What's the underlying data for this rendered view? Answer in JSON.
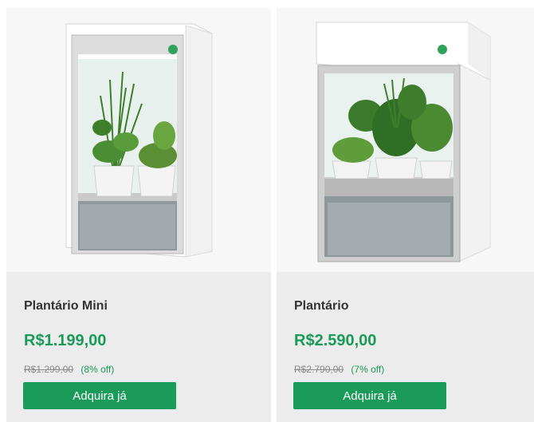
{
  "colors": {
    "accent": "#1a9b5a",
    "price": "#1a9b5a",
    "button_bg": "#1a9b5a",
    "button_text": "#ffffff",
    "strikethrough": "#8a8a8a"
  },
  "products": [
    {
      "name": "Plantário Mini",
      "price": "R$1.199,00",
      "old_price": "R$1.299,00",
      "discount": "(8% off)",
      "button_label": "Adquira já",
      "image_icon": "indoor-garden-mini-icon"
    },
    {
      "name": "Plantário",
      "price": "R$2.590,00",
      "old_price": "R$2.790,00",
      "discount": "(7% off)",
      "button_label": "Adquira já",
      "image_icon": "indoor-garden-icon"
    }
  ]
}
